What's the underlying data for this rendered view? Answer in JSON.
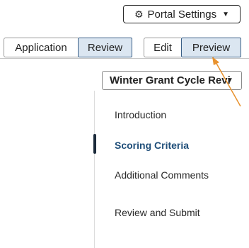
{
  "header": {
    "portal_settings_label": "Portal Settings",
    "gear_glyph": "⚙",
    "chevron_glyph": "▼"
  },
  "tabs": {
    "application": "Application",
    "review": "Review",
    "edit": "Edit",
    "preview": "Preview"
  },
  "cycle_select": {
    "value": "Winter Grant Cycle Review",
    "chevron_glyph": "▼"
  },
  "nav": {
    "items": [
      {
        "label": "Introduction"
      },
      {
        "label": "Scoring Criteria"
      },
      {
        "label": "Additional Comments"
      },
      {
        "label": "Review and Submit"
      }
    ],
    "active_index": 1
  },
  "colors": {
    "selected_tab_bg": "#dbe6f1",
    "selected_tab_border": "#3a5f86",
    "active_nav_text": "#1f4e79",
    "active_marker": "#1b2a3a",
    "annotation_arrow": "#e8922e"
  }
}
